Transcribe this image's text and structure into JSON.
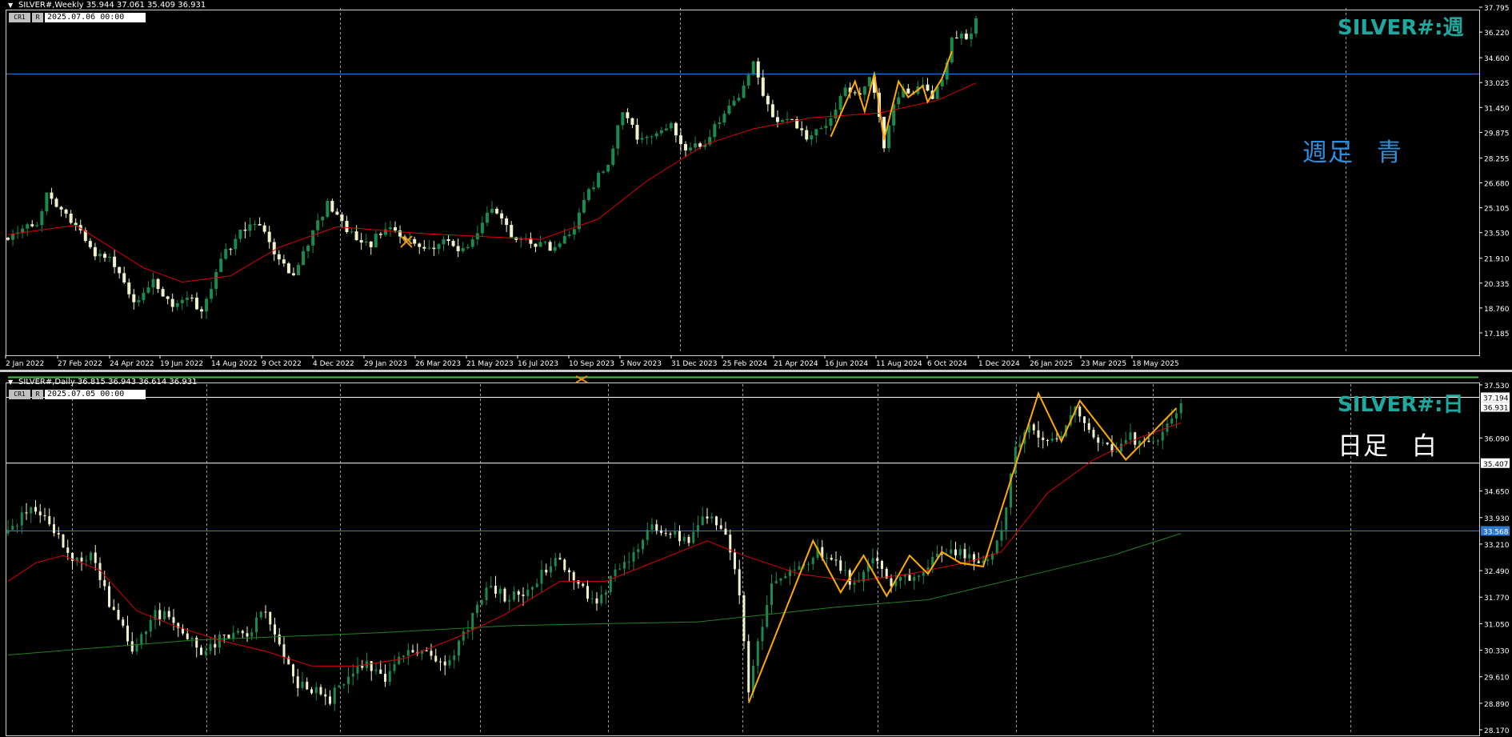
{
  "colors": {
    "background": "#000000",
    "bull_candle": "#1b8a4f",
    "bear_candle": "#f2f2c8",
    "ma_fast": "#dd0000",
    "ma_slow": "#208020",
    "zigzag": "#ffaa00",
    "hline_blue": "#2b79d0",
    "hline_white": "#ffffff",
    "axis_text": "#ffffff",
    "symbol_label": "#1fa89e",
    "weekly_note": "#2b8fe0",
    "daily_note": "#ffffff"
  },
  "weekly": {
    "info": "SILVER#,Weekly  35.944 37.061 35.409 36.931",
    "btn_cr1": "CR1",
    "btn_r": "R",
    "date_box": "2025.07.06 00:00",
    "symbol_label": "SILVER#:週",
    "note": "週足 青"
  },
  "daily": {
    "info": "SILVER#,Daily  36.815 36.943 36.614 36.931",
    "btn_cr1": "CR1",
    "btn_r": "R",
    "date_box": "2025.07.05 00:00",
    "symbol_label": "SILVER#:日",
    "note": "日足 白"
  },
  "chart_data": [
    {
      "type": "candlestick",
      "title": "SILVER#,Weekly",
      "y_ticks": [
        "37.795",
        "36.220",
        "34.600",
        "33.025",
        "31.450",
        "29.875",
        "28.255",
        "26.680",
        "25.105",
        "23.530",
        "21.910",
        "20.335",
        "18.760",
        "17.185"
      ],
      "ylim": [
        17.185,
        37.795
      ],
      "x_labels": [
        "2 Jan 2022",
        "27 Feb 2022",
        "24 Apr 2022",
        "19 Jun 2022",
        "14 Aug 2022",
        "9 Oct 2022",
        "4 Dec 2022",
        "29 Jan 2023",
        "26 Mar 2023",
        "21 May 2023",
        "16 Jul 2023",
        "10 Sep 2023",
        "5 Nov 2023",
        "31 Dec 2023",
        "25 Feb 2024",
        "21 Apr 2024",
        "16 Jun 2024",
        "11 Aug 2024",
        "6 Oct 2024",
        "1 Dec 2024",
        "26 Jan 2025",
        "23 Mar 2025",
        "18 May 2025"
      ],
      "hline": {
        "value": 33.568,
        "label": "33.568",
        "color": "blue"
      },
      "current_price": {
        "value": 36.931,
        "label": "36.931"
      },
      "anchors": [
        {
          "t": 0,
          "v": 23.2
        },
        {
          "t": 6,
          "v": 24.1
        },
        {
          "t": 8,
          "v": 25.9
        },
        {
          "t": 10,
          "v": 25.2
        },
        {
          "t": 14,
          "v": 24.0
        },
        {
          "t": 18,
          "v": 22.2
        },
        {
          "t": 22,
          "v": 21.6
        },
        {
          "t": 26,
          "v": 19.2
        },
        {
          "t": 30,
          "v": 20.4
        },
        {
          "t": 34,
          "v": 18.9
        },
        {
          "t": 37,
          "v": 19.5
        },
        {
          "t": 40,
          "v": 18.6
        },
        {
          "t": 44,
          "v": 21.8
        },
        {
          "t": 48,
          "v": 23.6
        },
        {
          "t": 52,
          "v": 24.0
        },
        {
          "t": 56,
          "v": 21.8
        },
        {
          "t": 59,
          "v": 20.8
        },
        {
          "t": 62,
          "v": 22.8
        },
        {
          "t": 66,
          "v": 25.4
        },
        {
          "t": 68,
          "v": 24.6
        },
        {
          "t": 71,
          "v": 23.4
        },
        {
          "t": 75,
          "v": 22.8
        },
        {
          "t": 78,
          "v": 24.0
        },
        {
          "t": 82,
          "v": 23.1
        },
        {
          "t": 86,
          "v": 22.6
        },
        {
          "t": 90,
          "v": 22.9
        },
        {
          "t": 93,
          "v": 22.4
        },
        {
          "t": 97,
          "v": 23.4
        },
        {
          "t": 100,
          "v": 25.3
        },
        {
          "t": 104,
          "v": 23.4
        },
        {
          "t": 108,
          "v": 23.0
        },
        {
          "t": 112,
          "v": 22.6
        },
        {
          "t": 116,
          "v": 23.3
        },
        {
          "t": 120,
          "v": 26.2
        },
        {
          "t": 124,
          "v": 28.0
        },
        {
          "t": 127,
          "v": 31.3
        },
        {
          "t": 130,
          "v": 29.5
        },
        {
          "t": 134,
          "v": 29.8
        },
        {
          "t": 137,
          "v": 30.6
        },
        {
          "t": 140,
          "v": 28.6
        },
        {
          "t": 144,
          "v": 29.3
        },
        {
          "t": 148,
          "v": 31.2
        },
        {
          "t": 151,
          "v": 32.2
        },
        {
          "t": 154,
          "v": 34.1
        },
        {
          "t": 158,
          "v": 30.6
        },
        {
          "t": 162,
          "v": 30.8
        },
        {
          "t": 165,
          "v": 29.6
        },
        {
          "t": 168,
          "v": 30.1
        },
        {
          "t": 171,
          "v": 31.4
        },
        {
          "t": 173,
          "v": 32.5
        },
        {
          "t": 176,
          "v": 32.3
        },
        {
          "t": 178,
          "v": 33.5
        },
        {
          "t": 180,
          "v": 31.0
        },
        {
          "t": 181,
          "v": 28.9
        },
        {
          "t": 183,
          "v": 31.8
        },
        {
          "t": 185,
          "v": 32.9
        },
        {
          "t": 187,
          "v": 32.3
        },
        {
          "t": 189,
          "v": 32.8
        },
        {
          "t": 191,
          "v": 32.0
        },
        {
          "t": 193,
          "v": 33.1
        },
        {
          "t": 195,
          "v": 35.9
        },
        {
          "t": 197,
          "v": 36.0
        },
        {
          "t": 199,
          "v": 35.9
        },
        {
          "t": 200,
          "v": 36.931
        }
      ],
      "ma": [
        {
          "t": 0,
          "v": 23.4
        },
        {
          "t": 14,
          "v": 24.0
        },
        {
          "t": 28,
          "v": 21.3
        },
        {
          "t": 36,
          "v": 20.4
        },
        {
          "t": 46,
          "v": 20.8
        },
        {
          "t": 56,
          "v": 22.6
        },
        {
          "t": 68,
          "v": 23.9
        },
        {
          "t": 84,
          "v": 23.5
        },
        {
          "t": 110,
          "v": 23.1
        },
        {
          "t": 122,
          "v": 24.4
        },
        {
          "t": 132,
          "v": 26.8
        },
        {
          "t": 144,
          "v": 29.1
        },
        {
          "t": 154,
          "v": 30.1
        },
        {
          "t": 166,
          "v": 30.8
        },
        {
          "t": 180,
          "v": 31.1
        },
        {
          "t": 192,
          "v": 31.9
        },
        {
          "t": 200,
          "v": 33.0
        }
      ],
      "zigzag": [
        {
          "t": 170,
          "v": 29.6
        },
        {
          "t": 175,
          "v": 33.1
        },
        {
          "t": 177,
          "v": 31.2
        },
        {
          "t": 179,
          "v": 33.6
        },
        {
          "t": 181,
          "v": 29.4
        },
        {
          "t": 184,
          "v": 33.1
        },
        {
          "t": 186,
          "v": 32.1
        },
        {
          "t": 189,
          "v": 32.8
        },
        {
          "t": 190,
          "v": 31.8
        },
        {
          "t": 193,
          "v": 33.3
        },
        {
          "t": 195,
          "v": 35.0
        }
      ]
    },
    {
      "type": "candlestick",
      "title": "SILVER#,Daily",
      "y_ticks": [
        "37.530",
        "37.194",
        "36.931",
        "36.090",
        "35.407",
        "34.650",
        "33.930",
        "33.568",
        "33.210",
        "32.490",
        "31.770",
        "31.050",
        "30.330",
        "29.610",
        "28.890",
        "28.170"
      ],
      "ylim": [
        28.17,
        37.53
      ],
      "hlines": [
        {
          "value": 37.194,
          "label": "37.194",
          "color": "white"
        },
        {
          "value": 35.407,
          "label": "35.407",
          "color": "white"
        },
        {
          "value": 33.568,
          "label": "33.568",
          "color": "blue"
        }
      ],
      "current_price": {
        "value": 36.931,
        "label": "36.931"
      },
      "anchors": [
        {
          "t": 0,
          "v": 33.5
        },
        {
          "t": 5,
          "v": 34.2
        },
        {
          "t": 10,
          "v": 33.6
        },
        {
          "t": 14,
          "v": 32.7
        },
        {
          "t": 18,
          "v": 32.9
        },
        {
          "t": 22,
          "v": 31.6
        },
        {
          "t": 27,
          "v": 30.4
        },
        {
          "t": 32,
          "v": 31.3
        },
        {
          "t": 36,
          "v": 31.2
        },
        {
          "t": 42,
          "v": 30.3
        },
        {
          "t": 48,
          "v": 30.8
        },
        {
          "t": 52,
          "v": 30.7
        },
        {
          "t": 55,
          "v": 31.5
        },
        {
          "t": 58,
          "v": 30.8
        },
        {
          "t": 62,
          "v": 29.5
        },
        {
          "t": 66,
          "v": 29.3
        },
        {
          "t": 70,
          "v": 29.0
        },
        {
          "t": 74,
          "v": 29.7
        },
        {
          "t": 78,
          "v": 29.9
        },
        {
          "t": 82,
          "v": 29.6
        },
        {
          "t": 86,
          "v": 30.3
        },
        {
          "t": 92,
          "v": 30.2
        },
        {
          "t": 96,
          "v": 30.0
        },
        {
          "t": 100,
          "v": 31.0
        },
        {
          "t": 104,
          "v": 32.0
        },
        {
          "t": 108,
          "v": 31.8
        },
        {
          "t": 112,
          "v": 31.8
        },
        {
          "t": 116,
          "v": 32.4
        },
        {
          "t": 120,
          "v": 32.8
        },
        {
          "t": 124,
          "v": 32.2
        },
        {
          "t": 128,
          "v": 31.5
        },
        {
          "t": 132,
          "v": 32.5
        },
        {
          "t": 136,
          "v": 33.0
        },
        {
          "t": 140,
          "v": 33.7
        },
        {
          "t": 144,
          "v": 33.5
        },
        {
          "t": 148,
          "v": 33.3
        },
        {
          "t": 152,
          "v": 34.0
        },
        {
          "t": 156,
          "v": 33.6
        },
        {
          "t": 159,
          "v": 31.8
        },
        {
          "t": 161,
          "v": 29.2
        },
        {
          "t": 163,
          "v": 30.6
        },
        {
          "t": 166,
          "v": 32.0
        },
        {
          "t": 170,
          "v": 32.6
        },
        {
          "t": 174,
          "v": 32.8
        },
        {
          "t": 176,
          "v": 33.0
        },
        {
          "t": 180,
          "v": 32.7
        },
        {
          "t": 184,
          "v": 32.1
        },
        {
          "t": 188,
          "v": 32.9
        },
        {
          "t": 192,
          "v": 32.2
        },
        {
          "t": 196,
          "v": 32.3
        },
        {
          "t": 200,
          "v": 32.6
        },
        {
          "t": 204,
          "v": 33.1
        },
        {
          "t": 208,
          "v": 32.9
        },
        {
          "t": 212,
          "v": 32.8
        },
        {
          "t": 215,
          "v": 33.2
        },
        {
          "t": 217,
          "v": 34.2
        },
        {
          "t": 219,
          "v": 35.8
        },
        {
          "t": 222,
          "v": 36.4
        },
        {
          "t": 226,
          "v": 35.9
        },
        {
          "t": 229,
          "v": 36.2
        },
        {
          "t": 232,
          "v": 37.0
        },
        {
          "t": 236,
          "v": 36.1
        },
        {
          "t": 240,
          "v": 35.7
        },
        {
          "t": 244,
          "v": 36.1
        },
        {
          "t": 248,
          "v": 35.9
        },
        {
          "t": 252,
          "v": 36.4
        },
        {
          "t": 255,
          "v": 36.931
        }
      ],
      "ma_fast": [
        {
          "t": 0,
          "v": 32.2
        },
        {
          "t": 6,
          "v": 32.7
        },
        {
          "t": 12,
          "v": 32.9
        },
        {
          "t": 20,
          "v": 32.5
        },
        {
          "t": 28,
          "v": 31.4
        },
        {
          "t": 36,
          "v": 31.0
        },
        {
          "t": 46,
          "v": 30.6
        },
        {
          "t": 56,
          "v": 30.3
        },
        {
          "t": 66,
          "v": 29.9
        },
        {
          "t": 76,
          "v": 29.9
        },
        {
          "t": 86,
          "v": 30.1
        },
        {
          "t": 98,
          "v": 30.7
        },
        {
          "t": 108,
          "v": 31.3
        },
        {
          "t": 120,
          "v": 32.2
        },
        {
          "t": 130,
          "v": 32.2
        },
        {
          "t": 140,
          "v": 32.7
        },
        {
          "t": 152,
          "v": 33.3
        },
        {
          "t": 160,
          "v": 32.9
        },
        {
          "t": 172,
          "v": 32.4
        },
        {
          "t": 184,
          "v": 32.2
        },
        {
          "t": 196,
          "v": 32.4
        },
        {
          "t": 208,
          "v": 32.7
        },
        {
          "t": 216,
          "v": 33.0
        },
        {
          "t": 226,
          "v": 34.6
        },
        {
          "t": 236,
          "v": 35.5
        },
        {
          "t": 246,
          "v": 36.1
        },
        {
          "t": 255,
          "v": 36.5
        }
      ],
      "ma_slow": [
        {
          "t": 0,
          "v": 30.2
        },
        {
          "t": 40,
          "v": 30.6
        },
        {
          "t": 80,
          "v": 30.8
        },
        {
          "t": 110,
          "v": 31.0
        },
        {
          "t": 150,
          "v": 31.1
        },
        {
          "t": 180,
          "v": 31.5
        },
        {
          "t": 200,
          "v": 31.7
        },
        {
          "t": 220,
          "v": 32.3
        },
        {
          "t": 240,
          "v": 32.9
        },
        {
          "t": 255,
          "v": 33.5
        }
      ],
      "zigzag": [
        {
          "t": 161,
          "v": 28.9
        },
        {
          "t": 175,
          "v": 33.3
        },
        {
          "t": 181,
          "v": 31.9
        },
        {
          "t": 186,
          "v": 32.9
        },
        {
          "t": 191,
          "v": 31.8
        },
        {
          "t": 196,
          "v": 32.9
        },
        {
          "t": 200,
          "v": 32.4
        },
        {
          "t": 203,
          "v": 33.0
        },
        {
          "t": 207,
          "v": 32.7
        },
        {
          "t": 212,
          "v": 32.6
        },
        {
          "t": 224,
          "v": 37.3
        },
        {
          "t": 229,
          "v": 36.0
        },
        {
          "t": 233,
          "v": 37.1
        },
        {
          "t": 243,
          "v": 35.5
        },
        {
          "t": 254,
          "v": 36.9
        }
      ]
    }
  ]
}
